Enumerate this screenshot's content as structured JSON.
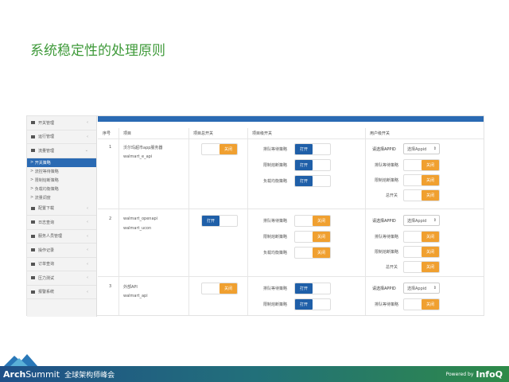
{
  "title": "系统稳定性的处理原则",
  "sidebar": {
    "items": [
      {
        "label": "开关管理",
        "chev": "‹"
      },
      {
        "label": "运行管理",
        "chev": "‹"
      },
      {
        "label": "流量管理",
        "chev": "⌄",
        "subs": [
          {
            "label": "开关策略",
            "active": true
          },
          {
            "label": "流控等待策略"
          },
          {
            "label": "限制熔断策略"
          },
          {
            "label": "负载均衡策略"
          },
          {
            "label": "流量调度"
          }
        ]
      },
      {
        "label": "配置下载",
        "chev": "‹"
      },
      {
        "label": "日志查询",
        "chev": "‹"
      },
      {
        "label": "服务人员管理",
        "chev": "‹"
      },
      {
        "label": "操作记录",
        "chev": "‹"
      },
      {
        "label": "订单查询",
        "chev": "‹"
      },
      {
        "label": "压力测试",
        "chev": "‹"
      },
      {
        "label": "报警系统",
        "chev": "‹"
      }
    ]
  },
  "table": {
    "headers": [
      "序号",
      "项目",
      "项目总开关",
      "项目级开关",
      "用户级开关"
    ],
    "rows": [
      {
        "no": "1",
        "name": "沃尔玛超市app服务器",
        "code": "walmart_e_api",
        "master": "off",
        "project": [
          {
            "label": "排队等待策略",
            "state": "on"
          },
          {
            "label": "限制熔断策略",
            "state": "on"
          },
          {
            "label": "负载均衡策略",
            "state": "on"
          }
        ],
        "user_label": "请选择APPID",
        "user_select": "选择Appid",
        "user": [
          {
            "label": "排队等待策略",
            "state": "off"
          },
          {
            "label": "限制熔断策略",
            "state": "off"
          },
          {
            "label": "总开关",
            "state": "off"
          }
        ]
      },
      {
        "no": "2",
        "name": "walmart_openapi",
        "code": "walmart_ucon",
        "master": "on",
        "project": [
          {
            "label": "排队等待策略",
            "state": "off"
          },
          {
            "label": "限制熔断策略",
            "state": "off"
          },
          {
            "label": "负载均衡策略",
            "state": "off"
          }
        ],
        "user_label": "请选择APPID",
        "user_select": "选择Appid",
        "user": [
          {
            "label": "排队等待策略",
            "state": "off"
          },
          {
            "label": "限制熔断策略",
            "state": "off"
          },
          {
            "label": "总开关",
            "state": "off"
          }
        ]
      },
      {
        "no": "3",
        "name": "外部API",
        "code": "walmart_api",
        "master": "off",
        "project": [
          {
            "label": "排队等待策略",
            "state": "on"
          },
          {
            "label": "限制熔断策略",
            "state": "on"
          }
        ],
        "user_label": "请选择APPID",
        "user_select": "选择Appid",
        "user": [
          {
            "label": "排队等待策略",
            "state": "off"
          }
        ]
      }
    ]
  },
  "toggle": {
    "on": "打开",
    "off": "关闭"
  },
  "footer": {
    "brand_a": "Arch",
    "brand_b": "Summit",
    "brand_cn": "全球架构师峰会",
    "powered": "Powered by",
    "infoq": "InfoQ"
  }
}
